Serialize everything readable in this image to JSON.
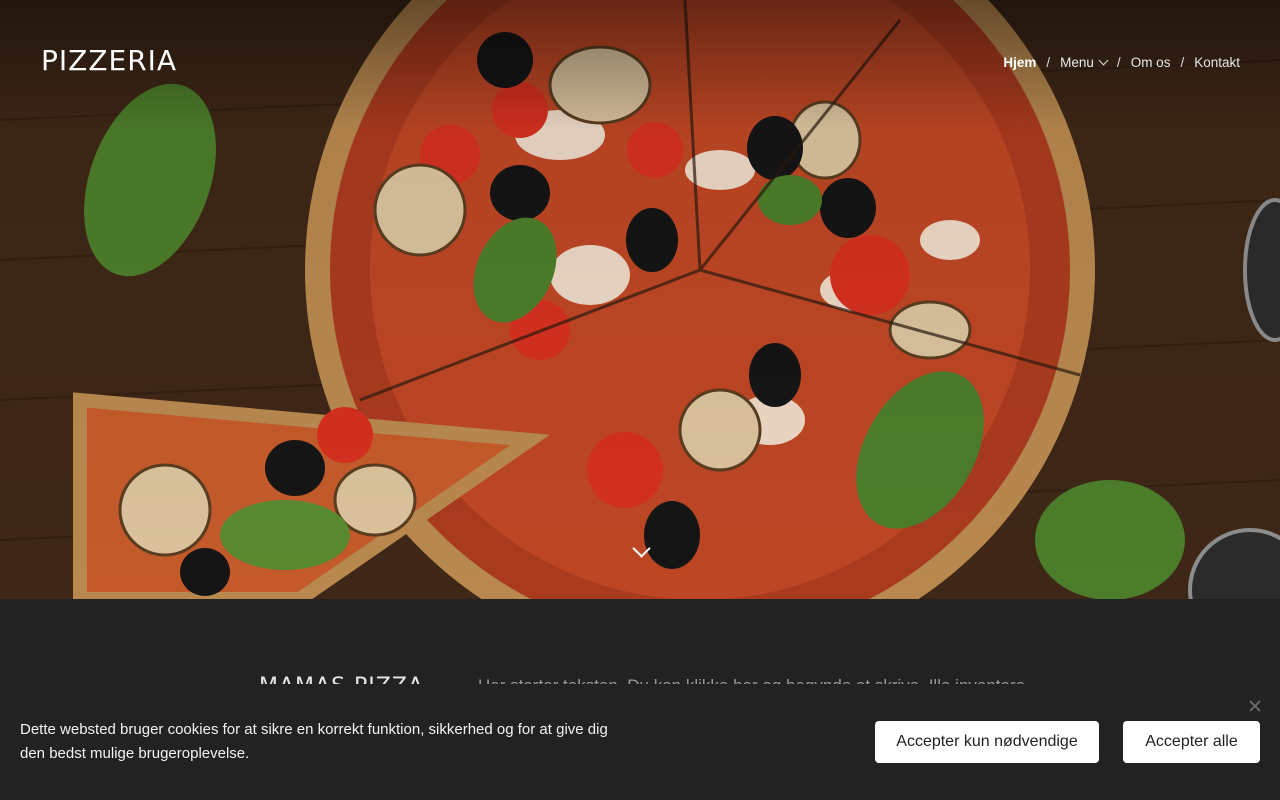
{
  "header": {
    "brand": "PIZZERIA",
    "nav": [
      {
        "label": "Hjem",
        "active": true
      },
      {
        "label": "Menu",
        "has_dropdown": true
      },
      {
        "label": "Om os"
      },
      {
        "label": "Kontakt"
      }
    ],
    "separator": "/"
  },
  "hero": {
    "image": "pizza-on-wooden-table",
    "scroll_icon": "chevron-down-icon"
  },
  "intro": {
    "heading": "MAMAS PIZZA",
    "text": "Her starter teksten. Du kan klikke her og begynde at skrive. Illo inventore"
  },
  "cookie_banner": {
    "message": "Dette websted bruger cookies for at sikre en korrekt funktion, sikkerhed og for at give dig den bedst mulige brugeroplevelse.",
    "accept_necessary_label": "Accepter kun nødvendige",
    "accept_all_label": "Accepter alle",
    "close_icon": "close-icon"
  },
  "colors": {
    "background_dark": "#222222",
    "button_bg": "#ffffff",
    "button_text": "#222222"
  }
}
